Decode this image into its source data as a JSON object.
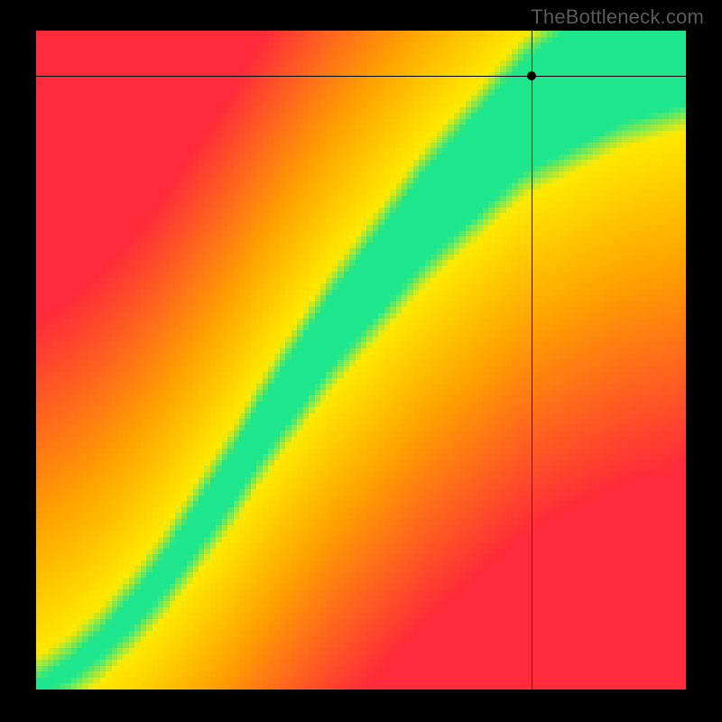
{
  "watermark": "TheBottleneck.com",
  "crosshair": {
    "x_frac": 0.762,
    "y_frac": 0.069
  },
  "colors": {
    "red": "#ff2a3a",
    "orange": "#ffa200",
    "yellow": "#ffe900",
    "green": "#1de68c"
  },
  "chart_data": {
    "type": "heatmap",
    "title": "",
    "xlabel": "",
    "ylabel": "",
    "xlim": [
      0,
      1
    ],
    "ylim": [
      0,
      1
    ],
    "grid": false,
    "legend_position": "none",
    "annotations": [
      "TheBottleneck.com watermark top-right",
      "crosshair marker with dot"
    ],
    "description": "Square heatmap: diagonal green band (optimal pairing) curving slightly, fading through yellow and orange to red toward corners. Black crosshair marks a point near upper-right inside/adjacent to the green band. Pixelated ~110x110 grid. No axis ticks or numeric labels visible.",
    "grid_resolution": 112,
    "ridge_points_xy": [
      [
        0.0,
        0.0
      ],
      [
        0.05,
        0.03
      ],
      [
        0.1,
        0.07
      ],
      [
        0.15,
        0.12
      ],
      [
        0.2,
        0.18
      ],
      [
        0.25,
        0.25
      ],
      [
        0.3,
        0.32
      ],
      [
        0.35,
        0.4
      ],
      [
        0.4,
        0.47
      ],
      [
        0.45,
        0.54
      ],
      [
        0.5,
        0.6
      ],
      [
        0.55,
        0.66
      ],
      [
        0.6,
        0.72
      ],
      [
        0.65,
        0.77
      ],
      [
        0.7,
        0.82
      ],
      [
        0.75,
        0.87
      ],
      [
        0.8,
        0.9
      ],
      [
        0.85,
        0.93
      ],
      [
        0.9,
        0.96
      ],
      [
        0.95,
        0.98
      ],
      [
        1.0,
        1.0
      ]
    ],
    "band_halfwidth_profile": [
      [
        0.0,
        0.01
      ],
      [
        0.1,
        0.018
      ],
      [
        0.2,
        0.028
      ],
      [
        0.3,
        0.038
      ],
      [
        0.4,
        0.048
      ],
      [
        0.5,
        0.058
      ],
      [
        0.6,
        0.068
      ],
      [
        0.7,
        0.078
      ],
      [
        0.8,
        0.09
      ],
      [
        0.9,
        0.1
      ],
      [
        1.0,
        0.11
      ]
    ],
    "color_stops_by_distance": [
      [
        0.0,
        "green"
      ],
      [
        0.06,
        "green"
      ],
      [
        0.1,
        "yellow"
      ],
      [
        0.3,
        "orange"
      ],
      [
        0.6,
        "red"
      ],
      [
        1.0,
        "red"
      ]
    ],
    "marker": {
      "x": 0.762,
      "y": 0.931
    }
  }
}
